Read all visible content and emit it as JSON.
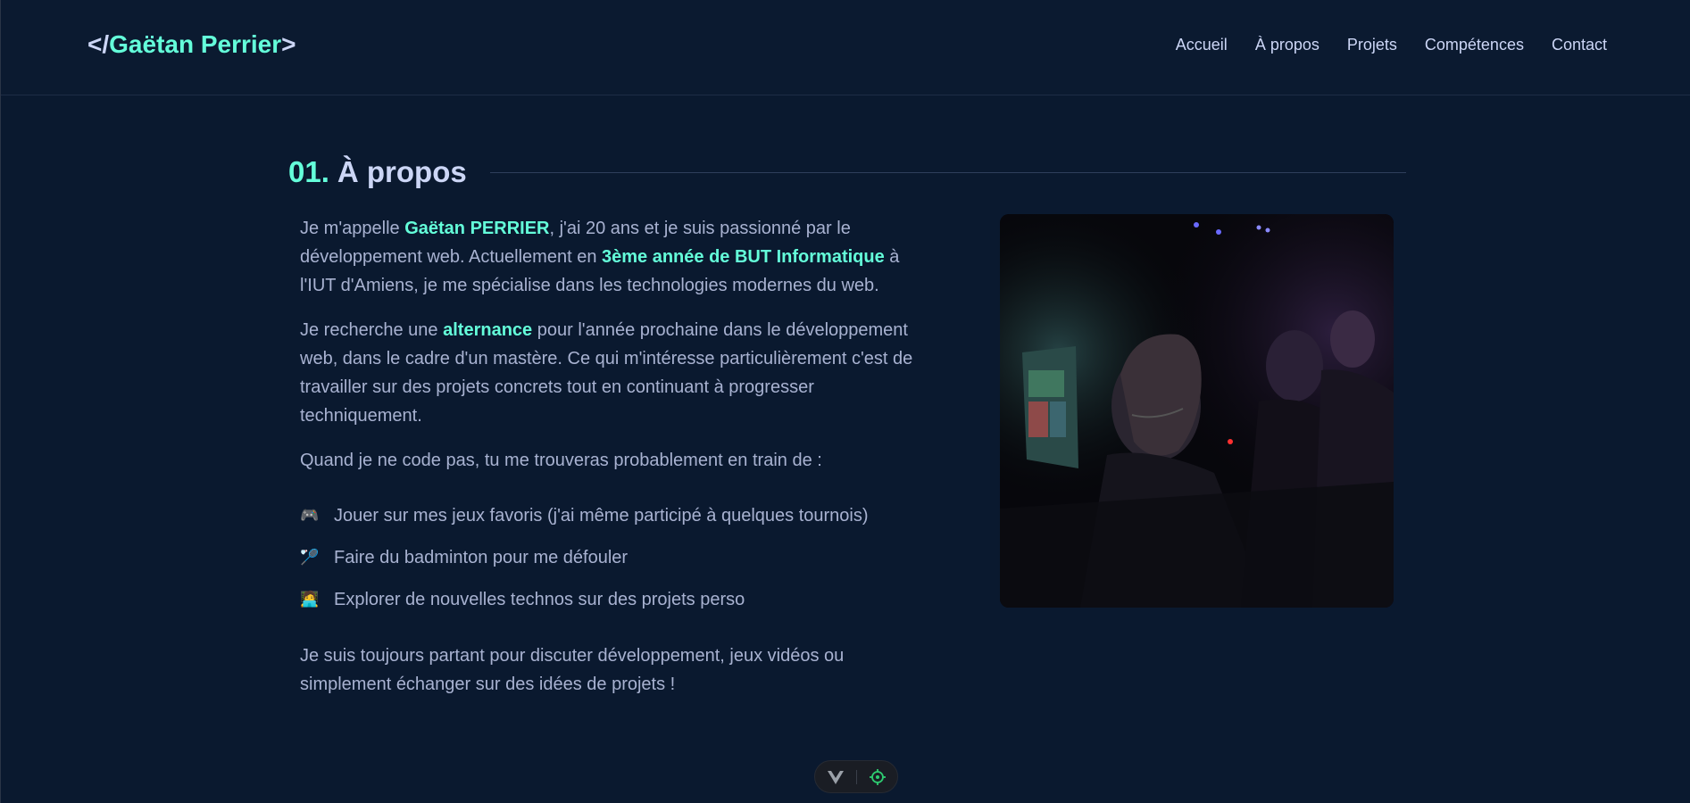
{
  "header": {
    "logo_prefix": "</",
    "logo_name": "Gaëtan Perrier",
    "logo_suffix": ">",
    "nav": [
      "Accueil",
      "À propos",
      "Projets",
      "Compétences",
      "Contact"
    ]
  },
  "section": {
    "number": "01.",
    "title": "À propos"
  },
  "about": {
    "p1": {
      "a": "Je m'appelle ",
      "name": "Gaëtan PERRIER",
      "b": ", j'ai 20 ans et je suis passionné par le développement web. Actuellement en ",
      "degree": "3ème année de BUT Informatique",
      "c": " à l'IUT d'Amiens, je me spécialise dans les technologies modernes du web."
    },
    "p2": {
      "a": "Je recherche une ",
      "keyword": "alternance",
      "b": " pour l'année prochaine dans le développement web, dans le cadre d'un mastère. Ce qui m'intéresse particulièrement c'est de travailler sur des projets concrets tout en continuant à progresser techniquement."
    },
    "p3": "Quand je ne code pas, tu me trouveras probablement en train de :",
    "hobbies": [
      {
        "icon": "🎮",
        "text": "Jouer sur mes jeux favoris (j'ai même participé à quelques tournois)"
      },
      {
        "icon": "🏸",
        "text": "Faire du badminton pour me défouler"
      },
      {
        "icon": "🧑‍💻",
        "text": "Explorer de nouvelles technos sur des projets perso"
      }
    ],
    "p4": "Je suis toujours partant pour discuter développement, jeux vidéos ou simplement échanger sur des idées de projets !"
  },
  "colors": {
    "background": "#0a192f",
    "accent": "#64ffda",
    "heading": "#ccd6f6",
    "body_text": "#a8b2d1"
  }
}
